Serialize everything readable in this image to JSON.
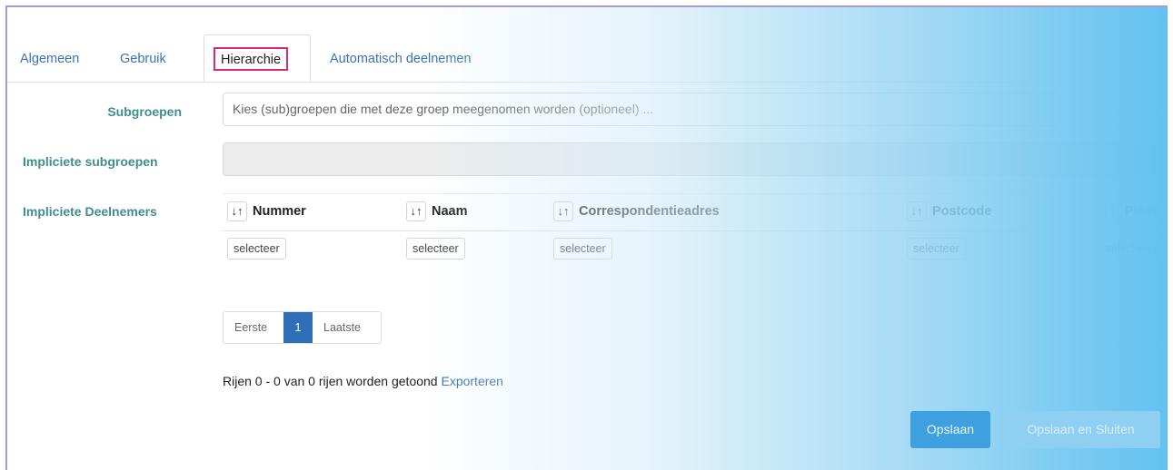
{
  "tabs": [
    {
      "label": "Algemeen"
    },
    {
      "label": "Gebruik"
    },
    {
      "label": "Hierarchie"
    },
    {
      "label": "Automatisch deelnemen"
    }
  ],
  "form": {
    "subgroepen": {
      "label": "Subgroepen",
      "placeholder": "Kies (sub)groepen die met deze groep meegenomen worden (optioneel) ..."
    },
    "impliciete_subgroepen": {
      "label": "Impliciete subgroepen"
    },
    "impliciete_deelnemers": {
      "label": "Impliciete Deelnemers"
    }
  },
  "table": {
    "sort_glyph": "↓↑",
    "columns": [
      {
        "header": "Nummer",
        "filter": "selecteer"
      },
      {
        "header": "Naam",
        "filter": "selecteer"
      },
      {
        "header": "Correspondentieadres",
        "filter": "selecteer"
      },
      {
        "header": "Postcode",
        "filter": "selecteer"
      },
      {
        "header": "Plaats",
        "filter": "selecteer"
      }
    ]
  },
  "pagination": {
    "first": "Eerste",
    "current": "1",
    "last": "Laatste"
  },
  "rows_info": {
    "text": "Rijen 0 - 0 van 0 rijen worden getoond",
    "export_link": "Exporteren"
  },
  "buttons": {
    "save": "Opslaan",
    "save_close": "Opslaan en Sluiten"
  },
  "colors": {
    "accent": "#3a73b0",
    "label": "#3f8e8e",
    "highlight_border": "#d6287a",
    "active_page": "#2f6fb8"
  }
}
